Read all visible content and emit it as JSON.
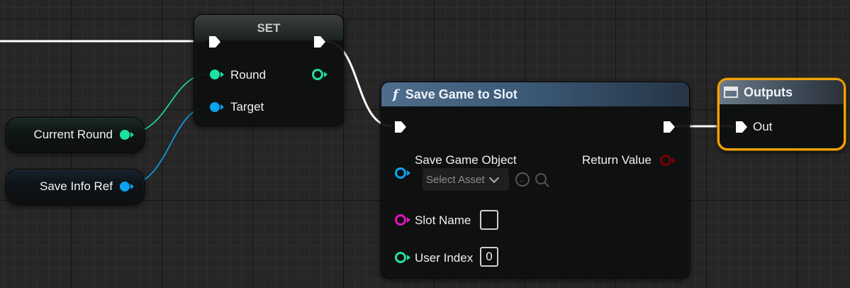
{
  "nodes": {
    "current_round": {
      "label": "Current Round"
    },
    "save_info_ref": {
      "label": "Save Info Ref"
    },
    "set": {
      "title": "SET",
      "pins": {
        "round": "Round",
        "target": "Target"
      }
    },
    "save_game_to_slot": {
      "icon": "function-icon",
      "title": "Save Game to Slot",
      "pins": {
        "save_game_object": "Save Game Object",
        "return_value": "Return Value",
        "slot_name": "Slot Name",
        "user_index": "User Index"
      },
      "asset_picker": {
        "placeholder": "Select Asset"
      },
      "slot_name_value": "",
      "user_index_value": "0"
    },
    "outputs": {
      "icon": "window-icon",
      "title": "Outputs",
      "pins": {
        "out": "Out"
      }
    }
  },
  "colors": {
    "integer_pin": "#1fe0a4",
    "object_pin": "#0aa3f0",
    "string_pin": "#e012c2",
    "return_pin": "#7a0000",
    "exec": "#ffffff",
    "output_highlight": "#f2a308",
    "function_header": "#4f6d8c"
  }
}
